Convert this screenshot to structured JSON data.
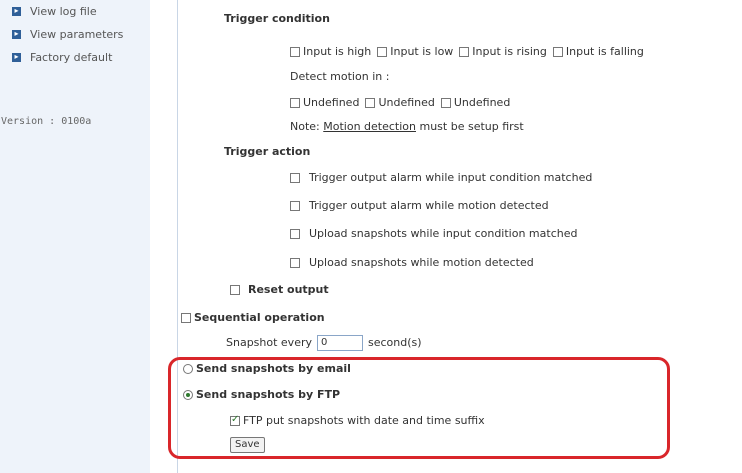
{
  "sidebar": {
    "items": [
      {
        "label": "View log file",
        "icon": "arrow-right-icon"
      },
      {
        "label": "View parameters",
        "icon": "arrow-right-icon"
      },
      {
        "label": "Factory default",
        "icon": "arrow-right-icon"
      }
    ],
    "version": "Version : 0100a"
  },
  "trigger_condition": {
    "heading": "Trigger condition",
    "inputs": [
      "Input is high",
      "Input is low",
      "Input is rising",
      "Input is falling"
    ],
    "detect_label": "Detect motion in :",
    "motion_windows": [
      "Undefined",
      "Undefined",
      "Undefined"
    ],
    "note_prefix": "Note: ",
    "note_link": "Motion detection",
    "note_suffix": " must be setup first"
  },
  "trigger_action": {
    "heading": "Trigger action",
    "options": [
      "Trigger output alarm while input condition matched",
      "Trigger output alarm while motion detected",
      "Upload snapshots while input condition matched",
      "Upload snapshots while motion detected"
    ]
  },
  "reset_output": {
    "label": "Reset output"
  },
  "sequential": {
    "label": "Sequential operation",
    "snapshot_prefix": "Snapshot every",
    "snapshot_value": "0",
    "snapshot_suffix": "second(s)"
  },
  "send": {
    "email_label": "Send snapshots by email",
    "ftp_label": "Send snapshots by FTP",
    "selected": "ftp",
    "ftp_suffix_label": "FTP put snapshots with date and time suffix",
    "ftp_suffix_checked": true
  },
  "save_button": {
    "label": "Save"
  },
  "colors": {
    "highlight": "#d9262a",
    "sidebar_bg": "#eef3fa",
    "accent": "#2f5f98"
  }
}
